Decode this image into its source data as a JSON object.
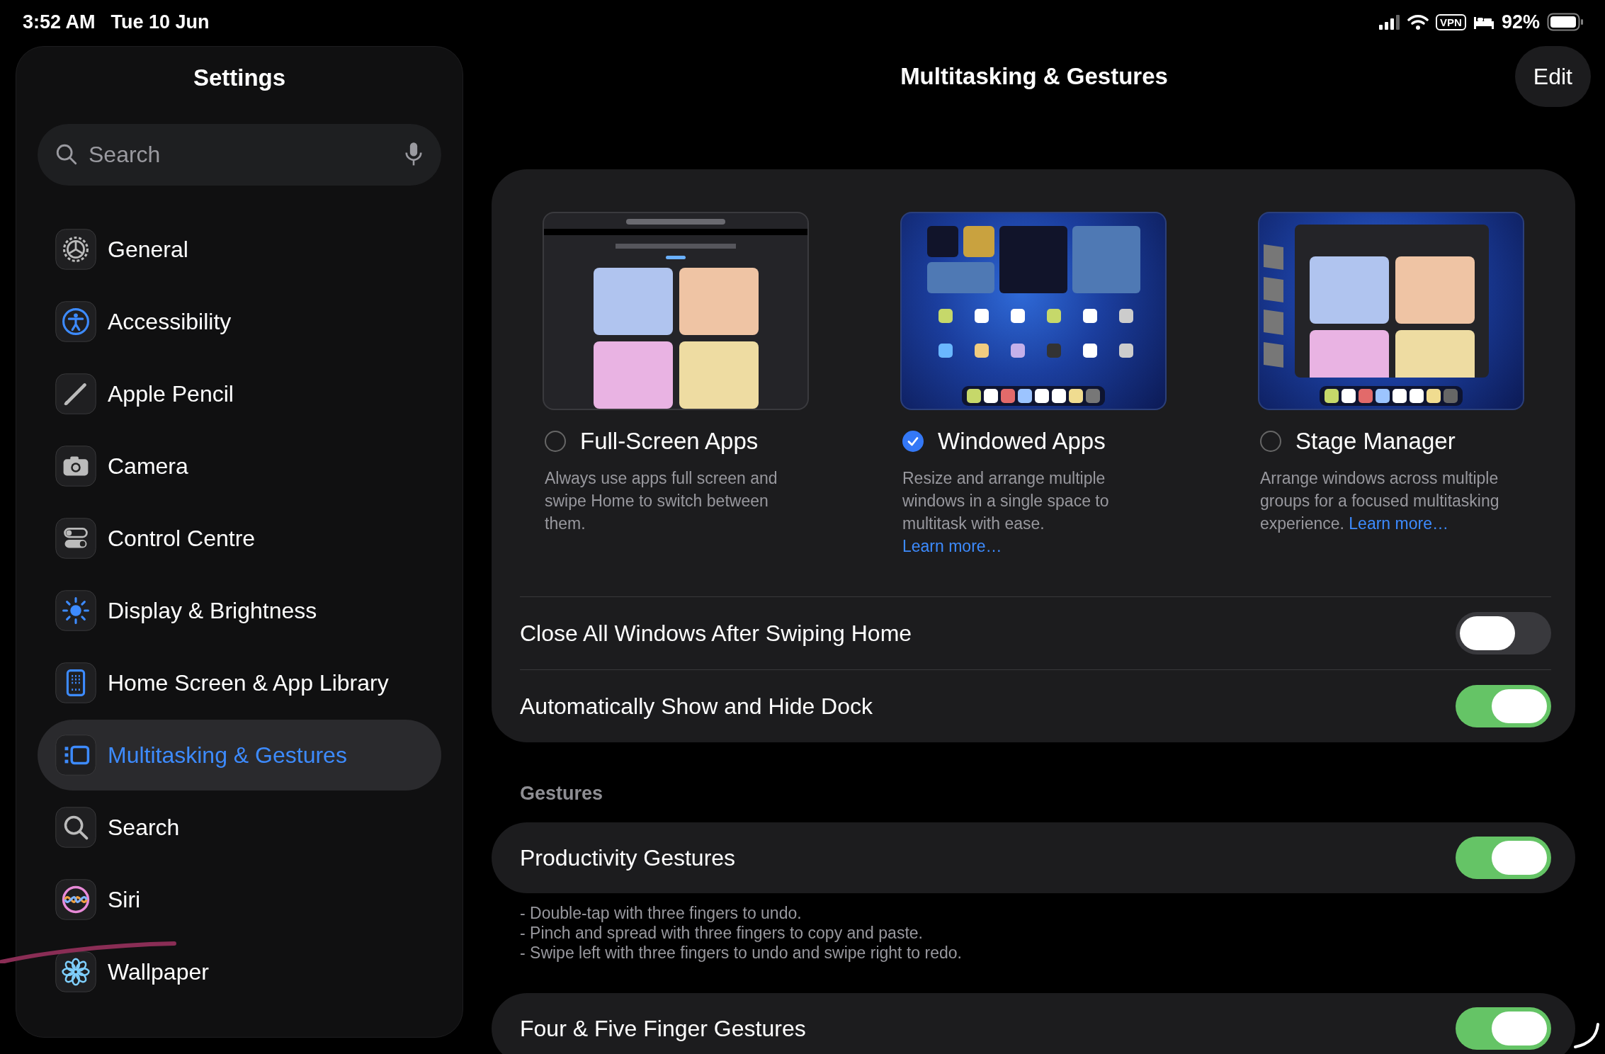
{
  "status_bar": {
    "time": "3:52 AM",
    "date": "Tue 10 Jun",
    "vpn": "VPN",
    "battery": "92%"
  },
  "sidebar": {
    "title": "Settings",
    "search": {
      "placeholder": "Search"
    },
    "items": [
      {
        "label": "General",
        "selected": false
      },
      {
        "label": "Accessibility",
        "selected": false
      },
      {
        "label": "Apple Pencil",
        "selected": false
      },
      {
        "label": "Camera",
        "selected": false
      },
      {
        "label": "Control Centre",
        "selected": false
      },
      {
        "label": "Display & Brightness",
        "selected": false
      },
      {
        "label": "Home Screen & App Library",
        "selected": false
      },
      {
        "label": "Multitasking & Gestures",
        "selected": true
      },
      {
        "label": "Search",
        "selected": false
      },
      {
        "label": "Siri",
        "selected": false
      },
      {
        "label": "Wallpaper",
        "selected": false
      }
    ]
  },
  "page": {
    "title": "Multitasking & Gestures",
    "edit_button": "Edit",
    "modes": [
      {
        "label": "Full-Screen Apps",
        "description": "Always use apps full screen and swipe Home to switch between them.",
        "selected": false
      },
      {
        "label": "Windowed Apps",
        "description": "Resize and arrange multiple windows in a single space to multitask with ease.",
        "link": "Learn more…",
        "selected": true
      },
      {
        "label": "Stage Manager",
        "description": "Arrange windows across multiple groups for a focused multitasking experience.",
        "link": "Learn more…",
        "selected": false
      }
    ],
    "rows": [
      {
        "label": "Close All Windows After Swiping Home",
        "on": false
      },
      {
        "label": "Automatically Show and Hide Dock",
        "on": true
      }
    ],
    "gestures": {
      "header": "Gestures",
      "rows": [
        {
          "label": "Productivity Gestures",
          "on": true,
          "footer_lines": [
            "- Double-tap with three fingers to undo.",
            "- Pinch and spread with three fingers to copy and paste.",
            "- Swipe left with three fingers to undo and swipe right to redo."
          ]
        },
        {
          "label": "Four & Five Finger Gestures",
          "on": true
        }
      ]
    }
  }
}
